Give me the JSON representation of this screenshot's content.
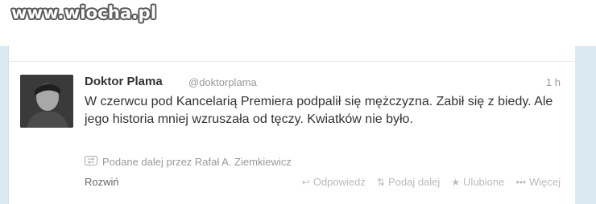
{
  "watermark": {
    "text": "www.wiocha.pl"
  },
  "tweet": {
    "author_name": "Doktor Plama",
    "author_handle": "@doktorplama",
    "time": "1 h",
    "text": "W czerwcu pod Kancelarią Premiera podpalił się mężczyzna. Zabił się z biedy. Ale jego historia mniej wzruszała od tęczy. Kwiatków nie było.",
    "retweeted_by": "Podane dalej przez Rafał A. Ziemkiewicz",
    "expand_label": "Rozwiń",
    "actions": {
      "reply": "Odpowiedź",
      "retweet": "Podaj dalej",
      "favorite": "Ulubione",
      "more": "Więcej"
    }
  },
  "icons": {
    "retweet_badge": "retweet-icon",
    "reply": "reply-icon",
    "retweet_action": "retweet-icon",
    "favorite": "star-icon",
    "more": "more-dots-icon"
  }
}
